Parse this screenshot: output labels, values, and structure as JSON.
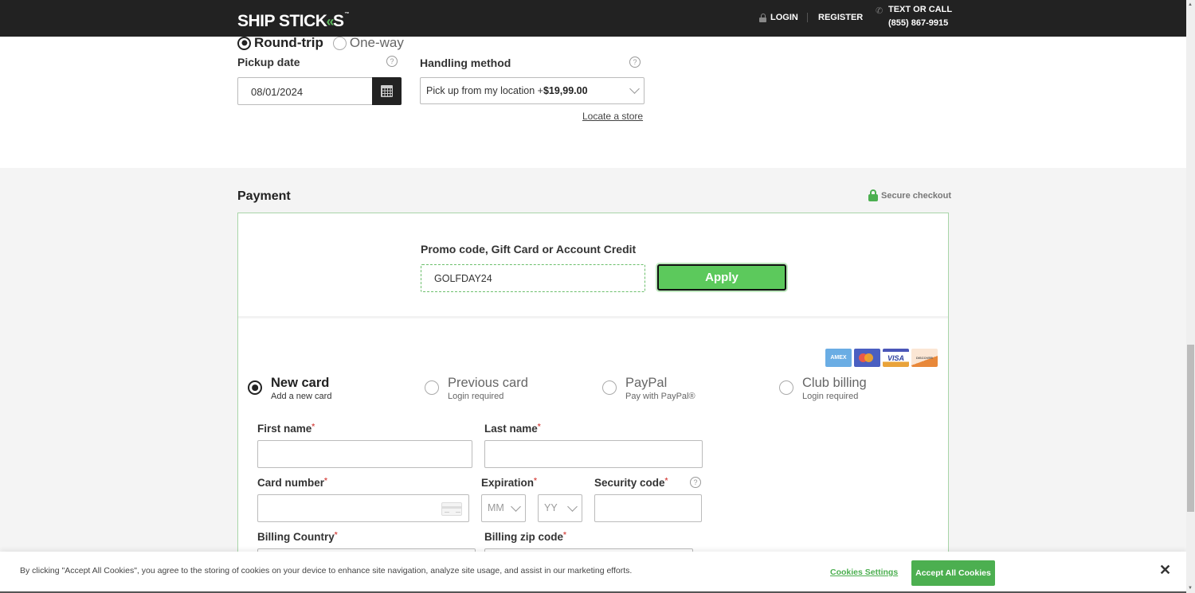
{
  "header": {
    "logo": {
      "text_main": "SHIP STICK",
      "text_end": "S",
      "trademark": "™"
    },
    "login_label": "LOGIN",
    "register_label": "REGISTER",
    "contact_line1": "TEXT OR CALL",
    "contact_line2": "(855) 867-9915"
  },
  "trip": {
    "options": [
      {
        "label": "Round-trip",
        "selected": true
      },
      {
        "label": "One-way",
        "selected": false
      }
    ]
  },
  "pickup": {
    "label": "Pickup date",
    "value": "08/01/2024",
    "help_glyph": "?"
  },
  "handling": {
    "label": "Handling method",
    "value_text": "Pick up from my location +",
    "value_price": "$19,99.00",
    "help_glyph": "?",
    "locate_link": "Locate a store"
  },
  "payment": {
    "title": "Payment",
    "secure_label": "Secure checkout",
    "promo": {
      "label": "Promo code, Gift Card or Account Credit",
      "value": "GOLFDAY24",
      "apply_label": "Apply"
    },
    "card_logos": [
      {
        "name": "amex",
        "text": "AMEX"
      },
      {
        "name": "mastercard",
        "text": ""
      },
      {
        "name": "visa",
        "text": "VISA"
      },
      {
        "name": "discover",
        "text": "DISCOVER"
      }
    ],
    "methods": [
      {
        "title": "New card",
        "subtitle": "Add a new card",
        "selected": true
      },
      {
        "title": "Previous card",
        "subtitle": "Login required",
        "selected": false
      },
      {
        "title": "PayPal",
        "subtitle": "Pay with PayPal®",
        "selected": false
      },
      {
        "title": "Club billing",
        "subtitle": "Login required",
        "selected": false
      }
    ],
    "fields": {
      "first_name": {
        "label": "First name",
        "value": ""
      },
      "last_name": {
        "label": "Last name",
        "value": ""
      },
      "card_number": {
        "label": "Card number",
        "value": ""
      },
      "expiration": {
        "label": "Expiration",
        "month_placeholder": "MM",
        "year_placeholder": "YY"
      },
      "security_code": {
        "label": "Security code",
        "value": "",
        "help_glyph": "?"
      },
      "billing_country": {
        "label": "Billing Country"
      },
      "billing_zip": {
        "label": "Billing zip code"
      },
      "required_mark": "*"
    }
  },
  "cookie_banner": {
    "text": "By clicking \"Accept All Cookies\", you agree to the storing of cookies on your device to enhance site navigation, analyze site usage, and assist in our marketing efforts.",
    "settings_label": "Cookies Settings",
    "accept_label": "Accept All Cookies",
    "close_glyph": "✕"
  },
  "colors": {
    "header_bg": "#222222",
    "brand_green": "#4caf50",
    "apply_green": "#5cc95c",
    "required_red": "#d9534f"
  }
}
